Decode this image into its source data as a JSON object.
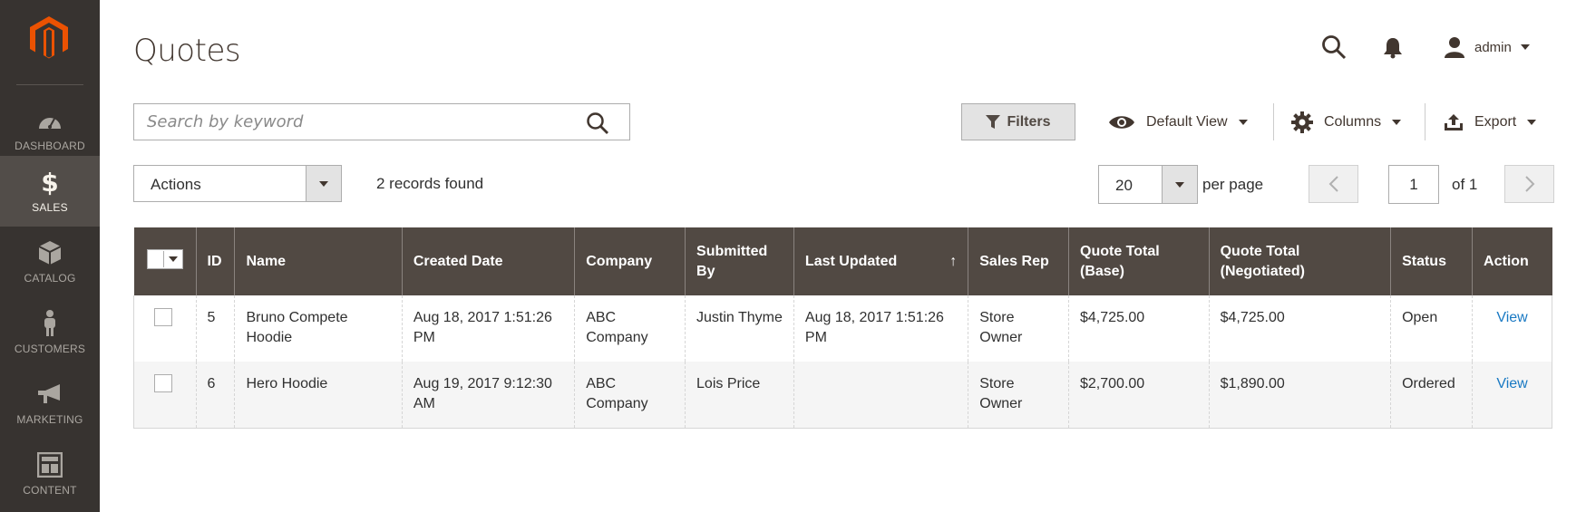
{
  "sidebar": {
    "items": [
      {
        "label": "Dashboard",
        "icon": "dashboard-icon"
      },
      {
        "label": "Sales",
        "icon": "dollar-icon",
        "active": true
      },
      {
        "label": "Catalog",
        "icon": "box-icon"
      },
      {
        "label": "Customers",
        "icon": "person-icon"
      },
      {
        "label": "Marketing",
        "icon": "megaphone-icon"
      },
      {
        "label": "Content",
        "icon": "layout-icon"
      }
    ]
  },
  "header": {
    "title": "Quotes",
    "user": "admin"
  },
  "search": {
    "placeholder": "Search by keyword"
  },
  "toolbar": {
    "filters_label": "Filters",
    "view_label": "Default View",
    "columns_label": "Columns",
    "export_label": "Export"
  },
  "actions": {
    "label": "Actions",
    "records_text": "2 records found"
  },
  "pager": {
    "per_page_value": "20",
    "per_page_label": "per page",
    "current_page": "1",
    "of_label": "of 1"
  },
  "table": {
    "columns": [
      "ID",
      "Name",
      "Created Date",
      "Company",
      "Submitted By",
      "Last Updated",
      "Sales Rep",
      "Quote Total (Base)",
      "Quote Total (Negotiated)",
      "Status",
      "Action"
    ],
    "rows": [
      {
        "id": "5",
        "name": "Bruno Compete Hoodie",
        "created": "Aug 18, 2017 1:51:26 PM",
        "company": "ABC Company",
        "submitted_by": "Justin Thyme",
        "last_updated": "Aug 18, 2017 1:51:26 PM",
        "sales_rep": "Store Owner",
        "total_base": "$4,725.00",
        "total_negotiated": "$4,725.00",
        "status": "Open",
        "action": "View"
      },
      {
        "id": "6",
        "name": "Hero Hoodie",
        "created": "Aug 19, 2017 9:12:30 AM",
        "company": "ABC Company",
        "submitted_by": "Lois Price",
        "last_updated": "",
        "sales_rep": "Store Owner",
        "total_base": "$2,700.00",
        "total_negotiated": "$1,890.00",
        "status": "Ordered",
        "action": "View"
      }
    ]
  },
  "colors": {
    "sidebar_bg": "#373330",
    "sidebar_active": "#524d49",
    "table_header": "#514943",
    "logo_orange": "#eb5202",
    "link_blue": "#1979c3"
  }
}
